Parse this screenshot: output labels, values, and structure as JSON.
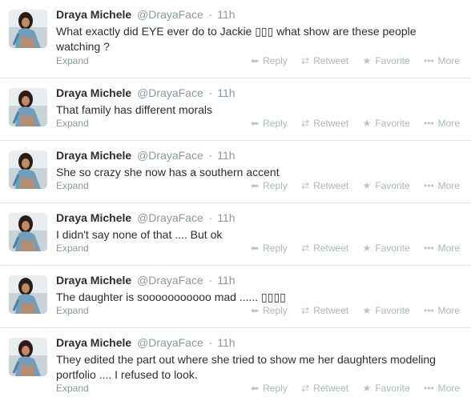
{
  "tweets": [
    {
      "fullname": "Draya Michele",
      "username": "@DrayaFace",
      "time": "11h",
      "text": "What exactly did EYE ever do to Jackie ▯▯▯ what show are these people watching ?"
    },
    {
      "fullname": "Draya Michele",
      "username": "@DrayaFace",
      "time": "11h",
      "text": "That family has different morals"
    },
    {
      "fullname": "Draya Michele",
      "username": "@DrayaFace",
      "time": "11h",
      "text": "She so crazy she now has a southern accent"
    },
    {
      "fullname": "Draya Michele",
      "username": "@DrayaFace",
      "time": "11h",
      "text": "I didn't say none of that .... But ok"
    },
    {
      "fullname": "Draya Michele",
      "username": "@DrayaFace",
      "time": "11h",
      "text": "The daughter is sooooooooooo mad ...... ▯▯▯▯"
    },
    {
      "fullname": "Draya Michele",
      "username": "@DrayaFace",
      "time": "11h",
      "text": "They edited the part out where she tried to show me her daughters modeling portfolio .... I refused to look."
    }
  ],
  "labels": {
    "expand": "Expand",
    "reply": "Reply",
    "retweet": "Retweet",
    "favorite": "Favorite",
    "more": "More",
    "dot": "·"
  },
  "icons": {
    "reply": "reply-arrow-icon",
    "retweet": "retweet-icon",
    "favorite": "star-icon",
    "more": "ellipsis-icon"
  },
  "colors": {
    "name": "#292f33",
    "muted": "#8899a6",
    "action": "#aab8c2",
    "divider": "#e1e8ed"
  }
}
